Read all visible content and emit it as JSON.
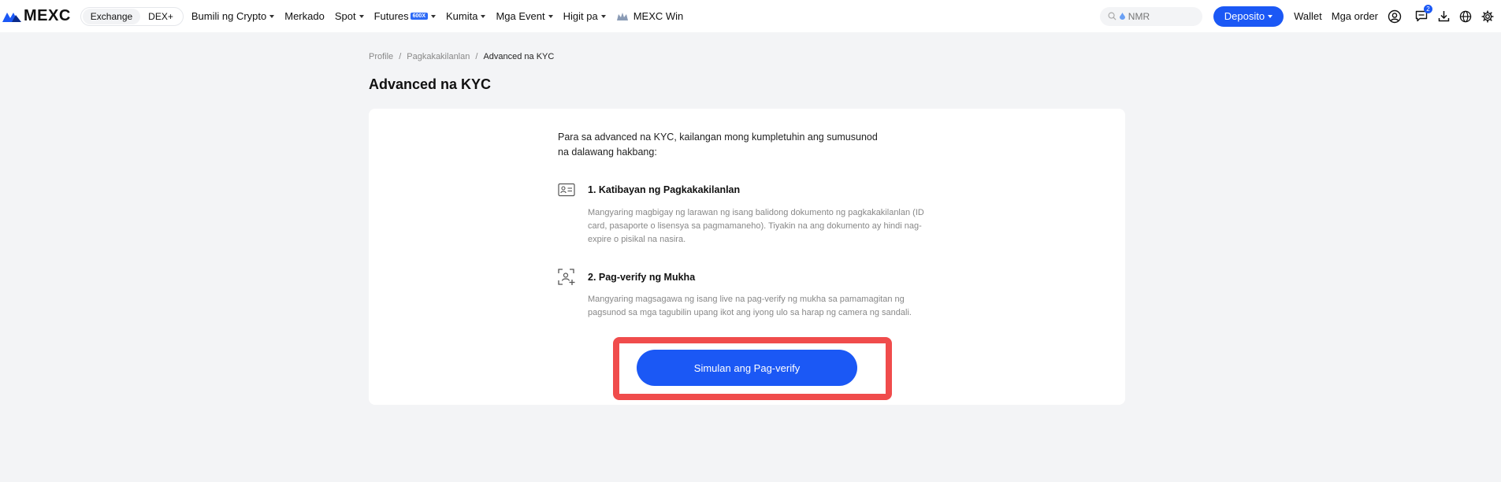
{
  "header": {
    "logo_text": "MEXC",
    "segment": [
      "Exchange",
      "DEX+"
    ],
    "nav": [
      {
        "label": "Bumili ng Crypto",
        "caret": true
      },
      {
        "label": "Merkado",
        "caret": false
      },
      {
        "label": "Spot",
        "caret": true
      },
      {
        "label": "Futures",
        "caret": true,
        "badge": "600X"
      },
      {
        "label": "Kumita",
        "caret": true
      },
      {
        "label": "Mga Event",
        "caret": true
      },
      {
        "label": "Higit pa",
        "caret": true
      },
      {
        "label": "MEXC Win",
        "caret": false
      }
    ],
    "search_placeholder": "NMR",
    "deposit_label": "Deposito",
    "wallet_label": "Wallet",
    "orders_label": "Mga order",
    "notification_count": "2",
    "accent_color": "#1b58f5"
  },
  "breadcrumb": {
    "items": [
      "Profile",
      "Pagkakakilanlan",
      "Advanced na KYC"
    ],
    "separator": "/"
  },
  "page_title": "Advanced na KYC",
  "card": {
    "intro": "Para sa advanced na KYC, kailangan mong kumpletuhin ang sumusunod na dalawang hakbang:",
    "steps": [
      {
        "icon": "id-card-icon",
        "title": "1. Katibayan ng Pagkakakilanlan",
        "description": "Mangyaring magbigay ng larawan ng isang balidong dokumento ng pagkakakilanlan (ID card, pasaporte o lisensya sa pagmamaneho). Tiyakin na ang dokumento ay hindi nag-expire o pisikal na nasira."
      },
      {
        "icon": "face-scan-icon",
        "title": "2. Pag-verify ng Mukha",
        "description": "Mangyaring magsagawa ng isang live na pag-verify ng mukha sa pamamagitan ng pagsunod sa mga tagubilin upang ikot ang iyong ulo sa harap ng camera ng sandali."
      }
    ],
    "button_label": "Simulan ang Pag-verify",
    "highlight_color": "#f04c4c"
  }
}
